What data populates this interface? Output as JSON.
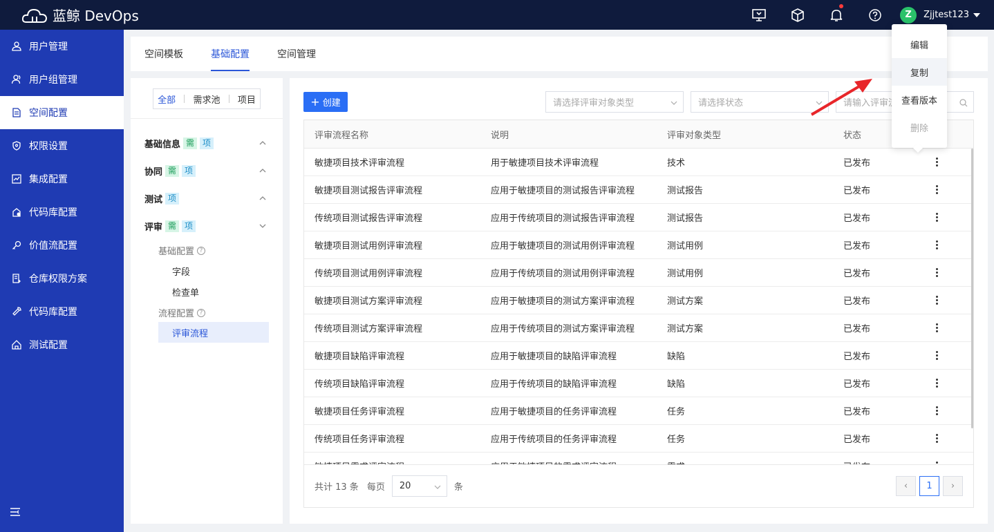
{
  "app": {
    "logo_text": "蓝鲸 DevOps"
  },
  "topbar": {
    "user_initial": "Z",
    "username": "Zjjtest123",
    "notification_dot_color": "#ff3b3b"
  },
  "sidebar": {
    "items": [
      {
        "label": "用户管理",
        "icon": "user-icon"
      },
      {
        "label": "用户组管理",
        "icon": "users-icon"
      },
      {
        "label": "空间配置",
        "icon": "doc-icon",
        "active": true
      },
      {
        "label": "权限设置",
        "icon": "shield-icon"
      },
      {
        "label": "集成配置",
        "icon": "chart-icon"
      },
      {
        "label": "代码库配置",
        "icon": "repo-icon"
      },
      {
        "label": "价值流配置",
        "icon": "key-icon"
      },
      {
        "label": "仓库权限方案",
        "icon": "file-icon"
      },
      {
        "label": "代码库配置",
        "icon": "wrench-icon"
      },
      {
        "label": "测试配置",
        "icon": "home-icon"
      }
    ]
  },
  "tabs": [
    {
      "label": "空间模板"
    },
    {
      "label": "基础配置",
      "active": true
    },
    {
      "label": "空间管理"
    }
  ],
  "left_panel": {
    "segments": [
      "全部",
      "需求池",
      "项目"
    ],
    "groups": [
      {
        "label": "基础信息",
        "tags": [
          "需",
          "项"
        ]
      },
      {
        "label": "协同",
        "tags": [
          "需",
          "项"
        ]
      },
      {
        "label": "测试",
        "tags": [
          "项"
        ]
      },
      {
        "label": "评审",
        "tags": [
          "需",
          "项"
        ]
      }
    ],
    "sub_basic": "基础配置",
    "sub_field": "字段",
    "sub_checklist": "检查单",
    "sub_flow": "流程配置",
    "sub_review_flow": "评审流程",
    "help_glyph": "?"
  },
  "toolbar": {
    "create_label": "创建",
    "create_plus": "+",
    "type_placeholder": "请选择评审对象类型",
    "status_placeholder": "请选择状态",
    "search_placeholder": "请输入评审流"
  },
  "table": {
    "headers": [
      "评审流程名称",
      "说明",
      "评审对象类型",
      "状态"
    ],
    "rows": [
      [
        "敏捷项目技术评审流程",
        "用于敏捷项目技术评审流程",
        "技术",
        "已发布"
      ],
      [
        "敏捷项目测试报告评审流程",
        "应用于敏捷项目的测试报告评审流程",
        "测试报告",
        "已发布"
      ],
      [
        "传统项目测试报告评审流程",
        "应用于传统项目的测试报告评审流程",
        "测试报告",
        "已发布"
      ],
      [
        "敏捷项目测试用例评审流程",
        "应用于敏捷项目的测试用例评审流程",
        "测试用例",
        "已发布"
      ],
      [
        "传统项目测试用例评审流程",
        "应用于传统项目的测试用例评审流程",
        "测试用例",
        "已发布"
      ],
      [
        "敏捷项目测试方案评审流程",
        "应用于敏捷项目的测试方案评审流程",
        "测试方案",
        "已发布"
      ],
      [
        "传统项目测试方案评审流程",
        "应用于传统项目的测试方案评审流程",
        "测试方案",
        "已发布"
      ],
      [
        "敏捷项目缺陷评审流程",
        "应用于敏捷项目的缺陷评审流程",
        "缺陷",
        "已发布"
      ],
      [
        "传统项目缺陷评审流程",
        "应用于传统项目的缺陷评审流程",
        "缺陷",
        "已发布"
      ],
      [
        "敏捷项目任务评审流程",
        "应用于敏捷项目的任务评审流程",
        "任务",
        "已发布"
      ],
      [
        "传统项目任务评审流程",
        "应用于传统项目的任务评审流程",
        "任务",
        "已发布"
      ],
      [
        "敏捷项目需求评审流程",
        "应用于敏捷项目的需求评审流程",
        "需求",
        "已发布"
      ]
    ]
  },
  "pagination": {
    "total_text": "共计 13 条",
    "per_page_label": "每页",
    "page_size": "20",
    "unit": "条",
    "current_page": "1",
    "prev_glyph": "‹",
    "next_glyph": "›"
  },
  "context_menu": {
    "items": [
      "编辑",
      "复制",
      "查看版本",
      "删除"
    ]
  },
  "colors": {
    "sidebar": "#1f3bb3",
    "topbar": "#0f1b3d",
    "accent": "#2a6ef5",
    "arrow": "#e8262a"
  }
}
